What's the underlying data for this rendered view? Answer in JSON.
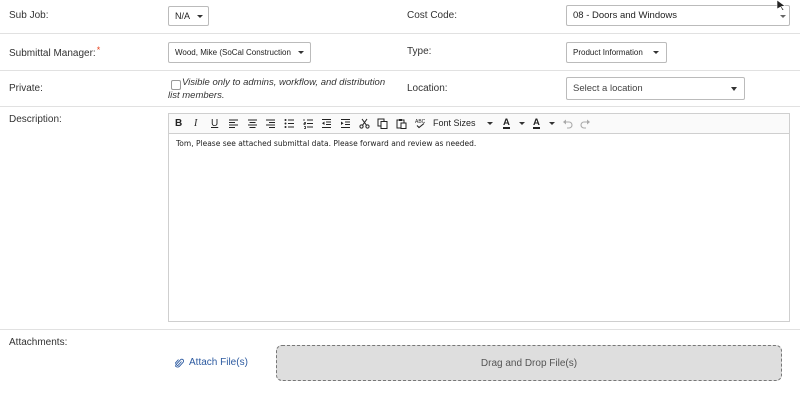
{
  "fields": {
    "sub_job": {
      "label": "Sub Job:",
      "value": "N/A"
    },
    "cost_code": {
      "label": "Cost Code:",
      "value": "08 - Doors and Windows"
    },
    "submittal_manager": {
      "label": "Submittal Manager:",
      "required_mark": "*",
      "value": "Wood, Mike (SoCal Construction)"
    },
    "type": {
      "label": "Type:",
      "value": "Product Information"
    },
    "private": {
      "label": "Private:",
      "checkbox_text": "Visible only to admins, workflow, and distribution list members.",
      "checked": false
    },
    "location": {
      "label": "Location:",
      "placeholder": "Select a location"
    },
    "description": {
      "label": "Description:"
    }
  },
  "editor": {
    "toolbar": {
      "bold": "B",
      "italic": "I",
      "underline": "U",
      "font_sizes": "Font Sizes",
      "text_color": "A",
      "bg_color": "A",
      "icons": [
        "align-left-icon",
        "align-center-icon",
        "align-right-icon",
        "bullet-list-icon",
        "numbered-list-icon",
        "outdent-icon",
        "indent-icon",
        "cut-icon",
        "copy-icon",
        "paste-icon",
        "spellcheck-icon",
        "undo-icon",
        "redo-icon"
      ]
    },
    "content": "Tom, Please see attached submittal data. Please forward and review as needed."
  },
  "attachments": {
    "label": "Attachments:",
    "attach_link": "Attach File(s)",
    "dropzone": "Drag and Drop File(s)"
  },
  "colors": {
    "accent_link": "#2c5aa0",
    "required": "#e8431f",
    "dropzone_bg": "#dedede"
  }
}
